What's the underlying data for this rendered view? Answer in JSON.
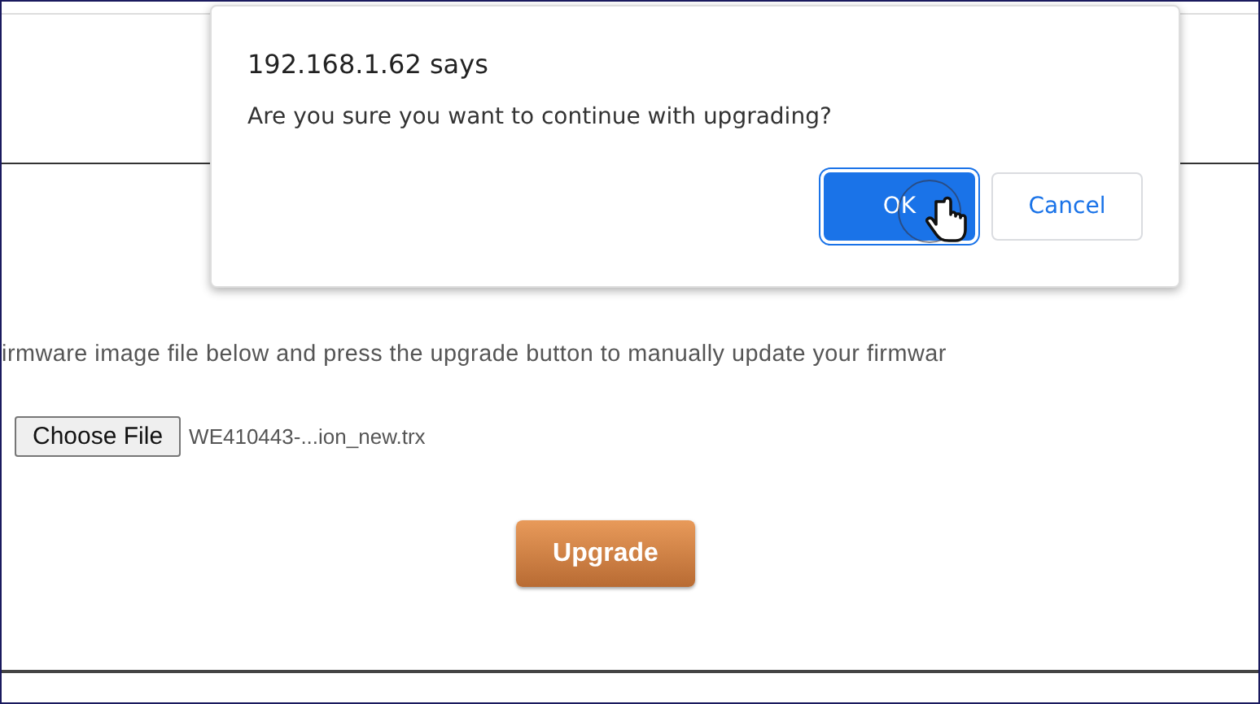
{
  "page": {
    "instruction": "irmware image file below and press the upgrade button to manually update your firmwar",
    "file_picker": {
      "button": "Choose File",
      "file_name": "WE410443-...ion_new.trx"
    },
    "upgrade_button": "Upgrade"
  },
  "dialog": {
    "title": "192.168.1.62 says",
    "message": "Are you sure you want to continue with upgrading?",
    "buttons": [
      {
        "label": "OK",
        "kind": "primary",
        "focused": true
      },
      {
        "label": "Cancel",
        "kind": "secondary",
        "focused": false
      }
    ]
  }
}
